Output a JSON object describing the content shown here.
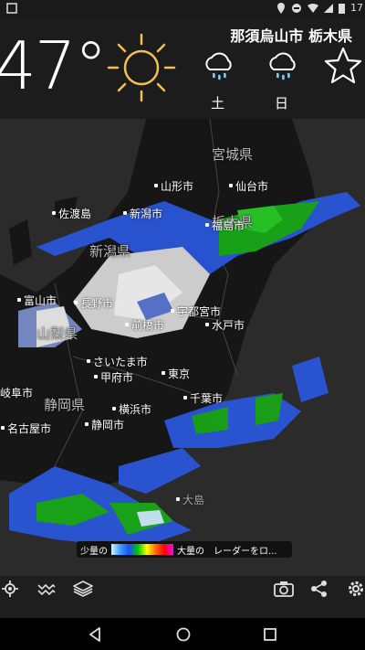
{
  "status_bar": {
    "time": "17"
  },
  "weather": {
    "temperature": "47°",
    "location": "那須烏山市 栃木県",
    "current_icon": "sun-icon",
    "forecast": [
      {
        "day": "土",
        "icon": "rain-cloud-icon"
      },
      {
        "day": "日",
        "icon": "rain-cloud-icon"
      }
    ]
  },
  "map": {
    "prefectures": [
      "宮城県",
      "新潟県",
      "栃木県",
      "静岡県",
      "山梨県"
    ],
    "cities": {
      "yamagata": "山形市",
      "sendai": "仙台市",
      "sado": "佐渡島",
      "niigata": "新潟市",
      "fukushima": "福島市",
      "toyama": "富山市",
      "nagano": "長野市",
      "utsunomiya": "宇都宮市",
      "maebashi": "前橋市",
      "mito": "水戸市",
      "saitama": "さいたま市",
      "kofu": "甲府市",
      "tokyo": "東京",
      "gifu": "岐阜市",
      "chiba": "千葉市",
      "yokohama": "横浜市",
      "nagoya": "名古屋市",
      "shizuoka": "静岡市",
      "oshima": "大島"
    }
  },
  "legend": {
    "low_label": "少量の",
    "high_label": "大量の",
    "radar_label": "レーダーをロ..."
  },
  "colors": {
    "header_bg": "#1c1c1c",
    "sun": "#f2c14e",
    "map_bg": "#2a2a2a"
  }
}
